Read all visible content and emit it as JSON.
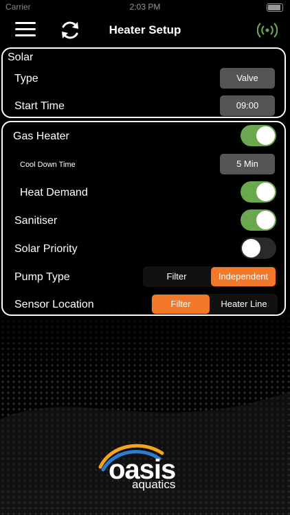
{
  "status_bar": {
    "carrier": "Carrier",
    "time": "2:03 PM"
  },
  "header": {
    "title": "Heater Setup"
  },
  "solar": {
    "section_title": "Solar",
    "type_label": "Type",
    "type_value": "Valve",
    "start_time_label": "Start Time",
    "start_time_value": "09:00"
  },
  "gas_heater": {
    "label": "Gas Heater",
    "enabled": true,
    "cool_down_label": "Cool Down Time",
    "cool_down_value": "5 Min",
    "heat_demand_label": "Heat Demand",
    "heat_demand_enabled": true,
    "sanitiser_label": "Sanitiser",
    "sanitiser_enabled": true,
    "solar_priority_label": "Solar Priority",
    "solar_priority_enabled": false,
    "pump_type_label": "Pump Type",
    "pump_type_options": [
      "Filter",
      "Independent"
    ],
    "pump_type_selected": "Independent",
    "sensor_location_label": "Sensor Location",
    "sensor_location_options": [
      "Filter",
      "Heater Line"
    ],
    "sensor_location_selected": "Filter"
  },
  "logo": {
    "word": "oasis",
    "sub": "aquatics"
  },
  "colors": {
    "accent": "#f4782a",
    "toggle_on": "#6aa84f",
    "signal": "#6aa84f",
    "chip_bg": "#555555"
  }
}
